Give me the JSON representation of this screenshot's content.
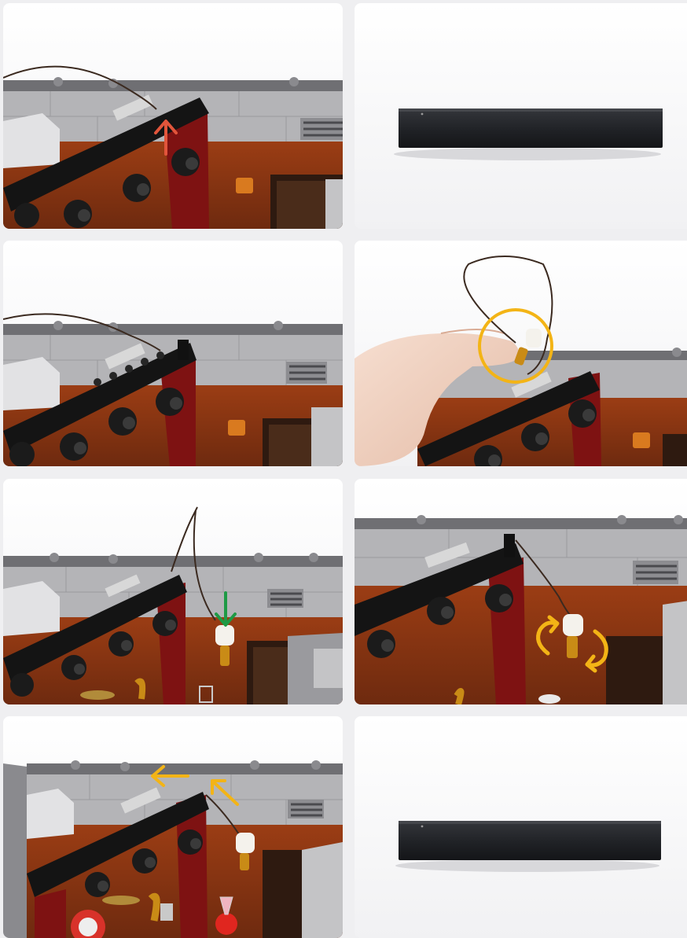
{
  "page": {
    "background": "#efeff1"
  },
  "colors": {
    "arrow_red": "#e2553b",
    "arrow_green": "#1e9a45",
    "arrow_yellow": "#f3b416",
    "wall_grey": "#a6a6a9",
    "brick_brown": "#8a3412",
    "curtain_red": "#7e1212",
    "rig_black": "#141414",
    "tile_dark": "#26282c"
  },
  "steps": [
    {
      "id": 1,
      "subject": "lighting-rig-remove-tile",
      "annotation": "arrow-up-icon"
    },
    {
      "id": 2,
      "subject": "black-1x6-tile"
    },
    {
      "id": 3,
      "subject": "lighting-rig-tile-removed"
    },
    {
      "id": 4,
      "subject": "hand-holding-light-brick",
      "annotation": "highlight-circle-icon"
    },
    {
      "id": 5,
      "subject": "place-light-brick",
      "annotation": "arrow-down-icon"
    },
    {
      "id": 6,
      "subject": "rotate-light-brick",
      "annotation": "rotate-arrows-icon"
    },
    {
      "id": 7,
      "subject": "route-wire-back",
      "annotation": "arrow-left-icon"
    },
    {
      "id": 8,
      "subject": "black-1x6-tile"
    }
  ]
}
